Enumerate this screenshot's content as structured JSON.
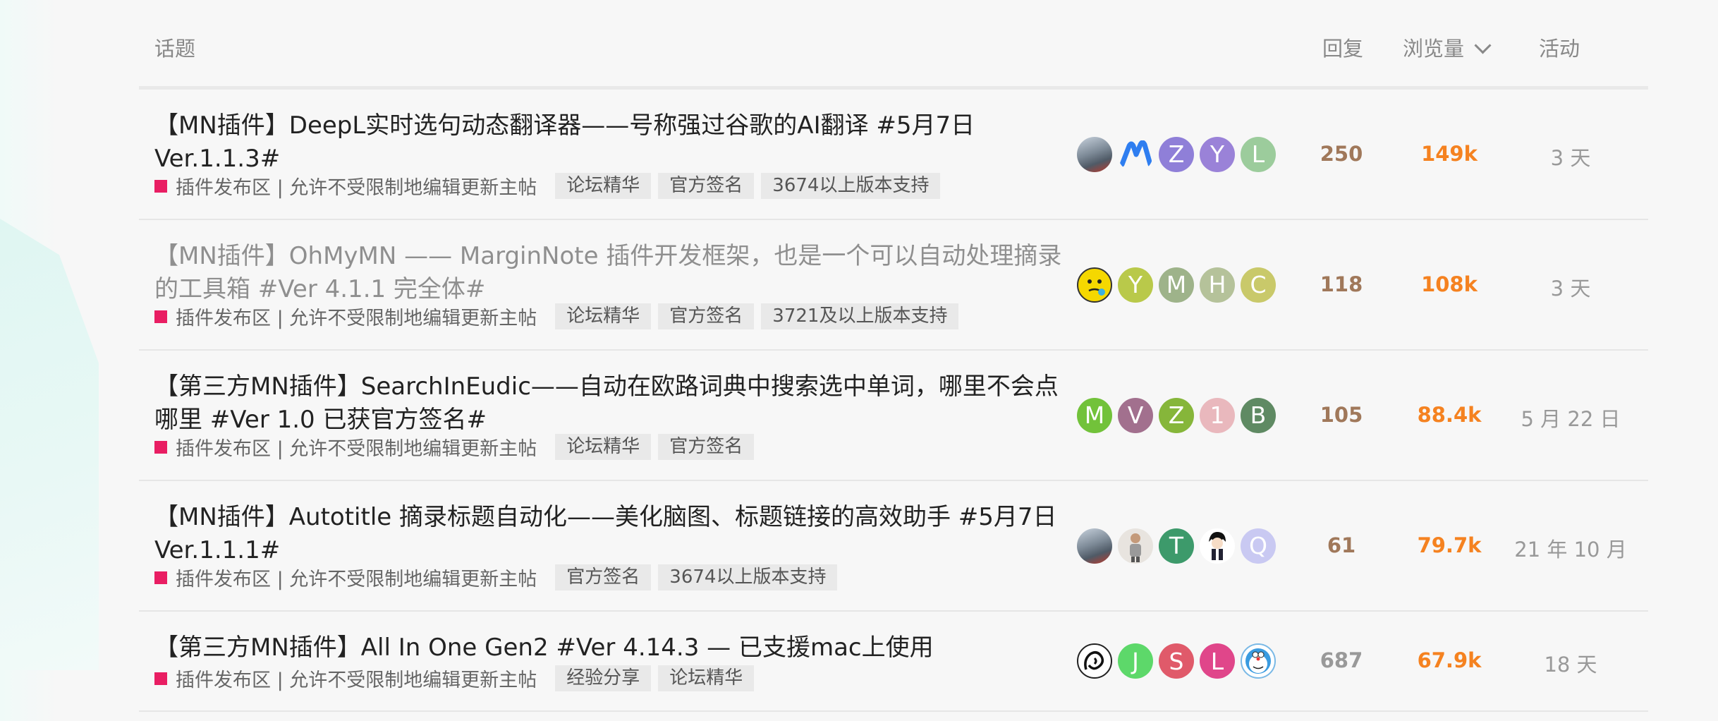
{
  "header": {
    "topic": "话题",
    "replies": "回复",
    "views": "浏览量",
    "activity": "活动"
  },
  "topics": [
    {
      "title_line1": "【MN插件】DeepL实时选句动态翻译器——号称强过谷歌的AI翻译 #5月7日",
      "title_line2": "Ver.1.1.3#",
      "category": "插件发布区 | 允许不受限制地编辑更新主帖",
      "tags": [
        "论坛精华",
        "官方签名",
        "3674以上版本支持"
      ],
      "posters": [
        {
          "kind": "photo",
          "color": "#7a8a99"
        },
        {
          "kind": "logo",
          "color": "#2f7ef0"
        },
        {
          "kind": "letter",
          "letter": "Z",
          "color": "#8f7fd8"
        },
        {
          "kind": "letter",
          "letter": "Y",
          "color": "#9a82d8"
        },
        {
          "kind": "letter",
          "letter": "L",
          "color": "#9ccc9c"
        }
      ],
      "replies": "250",
      "views": "149k",
      "activity": "3 天"
    },
    {
      "title_line1": "【MN插件】OhMyMN —— MarginNote 插件开发框架，也是一个可以自动处理摘录",
      "title_line2": "的工具箱 #Ver 4.1.1 完全体#",
      "category": "插件发布区 | 允许不受限制地编辑更新主帖",
      "tags": [
        "论坛精华",
        "官方签名",
        "3721及以上版本支持"
      ],
      "posters": [
        {
          "kind": "emoji",
          "color": "#f5d800"
        },
        {
          "kind": "letter",
          "letter": "Y",
          "color": "#b9c94a"
        },
        {
          "kind": "letter",
          "letter": "M",
          "color": "#9eb38a"
        },
        {
          "kind": "letter",
          "letter": "H",
          "color": "#b5c29a"
        },
        {
          "kind": "letter",
          "letter": "C",
          "color": "#c9c96a"
        }
      ],
      "replies": "118",
      "views": "108k",
      "activity": "3 天"
    },
    {
      "title_line1": "【第三方MN插件】SearchInEudic——自动在欧路词典中搜索选中单词，哪里不会点",
      "title_line2": "哪里 #Ver 1.0 已获官方签名#",
      "category": "插件发布区 | 允许不受限制地编辑更新主帖",
      "tags": [
        "论坛精华",
        "官方签名"
      ],
      "posters": [
        {
          "kind": "letter",
          "letter": "M",
          "color": "#72c23a"
        },
        {
          "kind": "letter",
          "letter": "V",
          "color": "#a2708e"
        },
        {
          "kind": "letter",
          "letter": "Z",
          "color": "#86b63a"
        },
        {
          "kind": "letter",
          "letter": "1",
          "color": "#e9b8bd"
        },
        {
          "kind": "letter",
          "letter": "B",
          "color": "#5f8a63"
        }
      ],
      "replies": "105",
      "views": "88.4k",
      "activity": "5 月 22 日"
    },
    {
      "title_line1": "【MN插件】Autotitle 摘录标题自动化——美化脑图、标题链接的高效助手 #5月7日",
      "title_line2": "Ver.1.1.1#",
      "category": "插件发布区 | 允许不受限制地编辑更新主帖",
      "tags": [
        "官方签名",
        "3674以上版本支持"
      ],
      "posters": [
        {
          "kind": "photo",
          "color": "#7a8a99"
        },
        {
          "kind": "figure",
          "color": "#e8e4df"
        },
        {
          "kind": "letter",
          "letter": "T",
          "color": "#3d9a6b"
        },
        {
          "kind": "anime",
          "color": "#ffffff"
        },
        {
          "kind": "letter",
          "letter": "Q",
          "color": "#c9c9f2"
        }
      ],
      "replies": "61",
      "views": "79.7k",
      "activity": "21 年 10 月"
    },
    {
      "title_line1": "【第三方MN插件】All In One Gen2 #Ver 4.14.3 — 已支援mac上使用",
      "title_line2": "",
      "category": "插件发布区 | 允许不受限制地编辑更新主帖",
      "tags": [
        "经验分享",
        "论坛精华"
      ],
      "posters": [
        {
          "kind": "sketch",
          "color": "#ffffff"
        },
        {
          "kind": "letter",
          "letter": "J",
          "color": "#5dd86a"
        },
        {
          "kind": "letter",
          "letter": "S",
          "color": "#e05a6a"
        },
        {
          "kind": "letter",
          "letter": "L",
          "color": "#e0468a"
        },
        {
          "kind": "doraemon",
          "color": "#3a9be0"
        }
      ],
      "replies": "687",
      "views": "67.9k",
      "activity": "18 天"
    }
  ]
}
